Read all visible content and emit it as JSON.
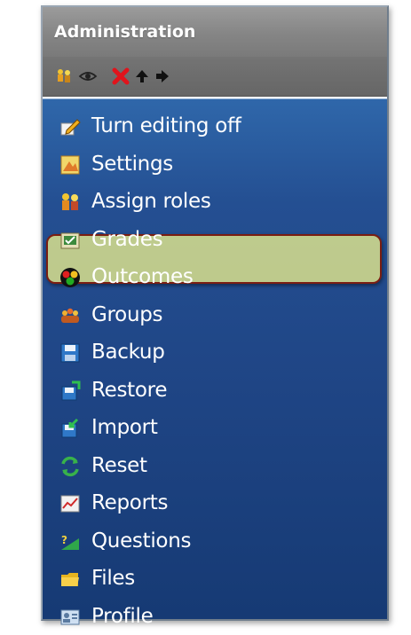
{
  "admin_block": {
    "title": "Administration",
    "toolbar": [
      {
        "icon": "assign-roles-icon"
      },
      {
        "icon": "eye-icon"
      },
      {
        "icon": "delete-x-icon"
      },
      {
        "icon": "arrow-up-icon"
      },
      {
        "icon": "arrow-right-icon"
      }
    ],
    "items": [
      {
        "label": "Turn editing off",
        "icon": "pencil-edit-icon"
      },
      {
        "label": "Settings",
        "icon": "settings-icon",
        "highlighted": true
      },
      {
        "label": "Assign roles",
        "icon": "assign-roles-icon"
      },
      {
        "label": "Grades",
        "icon": "grades-icon"
      },
      {
        "label": "Outcomes",
        "icon": "outcomes-icon"
      },
      {
        "label": "Groups",
        "icon": "groups-icon"
      },
      {
        "label": "Backup",
        "icon": "backup-icon"
      },
      {
        "label": "Restore",
        "icon": "restore-icon"
      },
      {
        "label": "Import",
        "icon": "import-icon"
      },
      {
        "label": "Reset",
        "icon": "reset-icon"
      },
      {
        "label": "Reports",
        "icon": "reports-icon"
      },
      {
        "label": "Questions",
        "icon": "questions-icon"
      },
      {
        "label": "Files",
        "icon": "folder-icon"
      },
      {
        "label": "Profile",
        "icon": "profile-icon"
      }
    ]
  },
  "colors": {
    "header_gray": "#858585",
    "menu_blue": "#244f92",
    "highlight": "#e1e68c",
    "highlight_border": "#7a1e12"
  }
}
